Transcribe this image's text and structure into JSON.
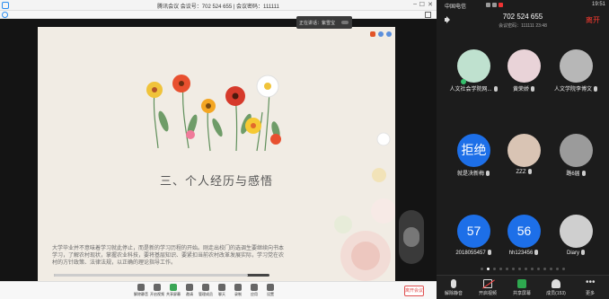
{
  "desktop": {
    "window_title": "腾讯会议 会议号：702 524 655 | 会议密码：111111",
    "speaker_label": "正在讲话：紫雪宝",
    "slide": {
      "title": "三、个人经历与感悟",
      "body": "大学毕业并不意味着学习就此停止，而是新的学习历程的开始。刚走出校门的选调生要继续向书本学习，了解农村现状，掌握农业科技，要将基层知识、要紧扣当前农村改革发展实际，学习党在农村的方针政策、法律法规，以正确的理论指导工作。"
    },
    "toolbar": {
      "items": [
        {
          "label": "解除静音"
        },
        {
          "label": "开启视频"
        },
        {
          "label": "共享屏幕"
        },
        {
          "label": "邀请"
        },
        {
          "label": "管理成员"
        },
        {
          "label": "聊天"
        },
        {
          "label": "录制"
        },
        {
          "label": "应用"
        },
        {
          "label": "设置"
        }
      ],
      "end_label": "离开会议"
    },
    "share_progress": 0.9
  },
  "phone": {
    "carrier": "中国电信",
    "time": "19:51",
    "meeting_number": "702 524 655",
    "meeting_meta": "会议密码：111111  23:48",
    "leave_label": "离开",
    "participants": [
      {
        "name": "人文社会学院网...",
        "avatar": "photo",
        "color": "#bfe1cf"
      },
      {
        "name": "黄荣娇",
        "avatar": "photo",
        "color": "#e9d3d8"
      },
      {
        "name": "人文学院李博文",
        "avatar": "photo",
        "color": "#b7b7b7"
      },
      {
        "name": "就是决新梅",
        "avatar": "text",
        "text": "拒绝"
      },
      {
        "name": "ZZZ",
        "avatar": "photo",
        "color": "#d9c4b4"
      },
      {
        "name": "路6届",
        "avatar": "photo",
        "color": "#9b9b9b"
      },
      {
        "name": "2018055457",
        "avatar": "text",
        "text": "57"
      },
      {
        "name": "hh123456",
        "avatar": "text",
        "text": "56"
      },
      {
        "name": "Diary",
        "avatar": "photo",
        "color": "#cfcfcf"
      }
    ],
    "page_dots": 14,
    "active_dot": 1,
    "bottom_bar": [
      {
        "label": "解除静音",
        "icon": "mic-icon"
      },
      {
        "label": "开启视频",
        "icon": "camera-off-icon"
      },
      {
        "label": "共享屏幕",
        "icon": "share-screen-icon"
      },
      {
        "label": "成员(153)",
        "icon": "members-icon"
      },
      {
        "label": "更多",
        "icon": "more-icon"
      }
    ]
  }
}
